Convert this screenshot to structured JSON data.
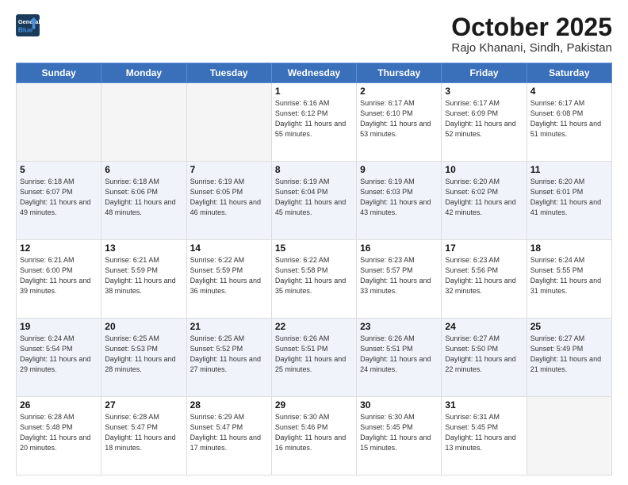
{
  "header": {
    "logo_line1": "General",
    "logo_line2": "Blue",
    "month": "October 2025",
    "location": "Rajo Khanani, Sindh, Pakistan"
  },
  "days_of_week": [
    "Sunday",
    "Monday",
    "Tuesday",
    "Wednesday",
    "Thursday",
    "Friday",
    "Saturday"
  ],
  "weeks": [
    [
      {
        "day": "",
        "sunrise": "",
        "sunset": "",
        "daylight": ""
      },
      {
        "day": "",
        "sunrise": "",
        "sunset": "",
        "daylight": ""
      },
      {
        "day": "",
        "sunrise": "",
        "sunset": "",
        "daylight": ""
      },
      {
        "day": "1",
        "sunrise": "Sunrise: 6:16 AM",
        "sunset": "Sunset: 6:12 PM",
        "daylight": "Daylight: 11 hours and 55 minutes."
      },
      {
        "day": "2",
        "sunrise": "Sunrise: 6:17 AM",
        "sunset": "Sunset: 6:10 PM",
        "daylight": "Daylight: 11 hours and 53 minutes."
      },
      {
        "day": "3",
        "sunrise": "Sunrise: 6:17 AM",
        "sunset": "Sunset: 6:09 PM",
        "daylight": "Daylight: 11 hours and 52 minutes."
      },
      {
        "day": "4",
        "sunrise": "Sunrise: 6:17 AM",
        "sunset": "Sunset: 6:08 PM",
        "daylight": "Daylight: 11 hours and 51 minutes."
      }
    ],
    [
      {
        "day": "5",
        "sunrise": "Sunrise: 6:18 AM",
        "sunset": "Sunset: 6:07 PM",
        "daylight": "Daylight: 11 hours and 49 minutes."
      },
      {
        "day": "6",
        "sunrise": "Sunrise: 6:18 AM",
        "sunset": "Sunset: 6:06 PM",
        "daylight": "Daylight: 11 hours and 48 minutes."
      },
      {
        "day": "7",
        "sunrise": "Sunrise: 6:19 AM",
        "sunset": "Sunset: 6:05 PM",
        "daylight": "Daylight: 11 hours and 46 minutes."
      },
      {
        "day": "8",
        "sunrise": "Sunrise: 6:19 AM",
        "sunset": "Sunset: 6:04 PM",
        "daylight": "Daylight: 11 hours and 45 minutes."
      },
      {
        "day": "9",
        "sunrise": "Sunrise: 6:19 AM",
        "sunset": "Sunset: 6:03 PM",
        "daylight": "Daylight: 11 hours and 43 minutes."
      },
      {
        "day": "10",
        "sunrise": "Sunrise: 6:20 AM",
        "sunset": "Sunset: 6:02 PM",
        "daylight": "Daylight: 11 hours and 42 minutes."
      },
      {
        "day": "11",
        "sunrise": "Sunrise: 6:20 AM",
        "sunset": "Sunset: 6:01 PM",
        "daylight": "Daylight: 11 hours and 41 minutes."
      }
    ],
    [
      {
        "day": "12",
        "sunrise": "Sunrise: 6:21 AM",
        "sunset": "Sunset: 6:00 PM",
        "daylight": "Daylight: 11 hours and 39 minutes."
      },
      {
        "day": "13",
        "sunrise": "Sunrise: 6:21 AM",
        "sunset": "Sunset: 5:59 PM",
        "daylight": "Daylight: 11 hours and 38 minutes."
      },
      {
        "day": "14",
        "sunrise": "Sunrise: 6:22 AM",
        "sunset": "Sunset: 5:59 PM",
        "daylight": "Daylight: 11 hours and 36 minutes."
      },
      {
        "day": "15",
        "sunrise": "Sunrise: 6:22 AM",
        "sunset": "Sunset: 5:58 PM",
        "daylight": "Daylight: 11 hours and 35 minutes."
      },
      {
        "day": "16",
        "sunrise": "Sunrise: 6:23 AM",
        "sunset": "Sunset: 5:57 PM",
        "daylight": "Daylight: 11 hours and 33 minutes."
      },
      {
        "day": "17",
        "sunrise": "Sunrise: 6:23 AM",
        "sunset": "Sunset: 5:56 PM",
        "daylight": "Daylight: 11 hours and 32 minutes."
      },
      {
        "day": "18",
        "sunrise": "Sunrise: 6:24 AM",
        "sunset": "Sunset: 5:55 PM",
        "daylight": "Daylight: 11 hours and 31 minutes."
      }
    ],
    [
      {
        "day": "19",
        "sunrise": "Sunrise: 6:24 AM",
        "sunset": "Sunset: 5:54 PM",
        "daylight": "Daylight: 11 hours and 29 minutes."
      },
      {
        "day": "20",
        "sunrise": "Sunrise: 6:25 AM",
        "sunset": "Sunset: 5:53 PM",
        "daylight": "Daylight: 11 hours and 28 minutes."
      },
      {
        "day": "21",
        "sunrise": "Sunrise: 6:25 AM",
        "sunset": "Sunset: 5:52 PM",
        "daylight": "Daylight: 11 hours and 27 minutes."
      },
      {
        "day": "22",
        "sunrise": "Sunrise: 6:26 AM",
        "sunset": "Sunset: 5:51 PM",
        "daylight": "Daylight: 11 hours and 25 minutes."
      },
      {
        "day": "23",
        "sunrise": "Sunrise: 6:26 AM",
        "sunset": "Sunset: 5:51 PM",
        "daylight": "Daylight: 11 hours and 24 minutes."
      },
      {
        "day": "24",
        "sunrise": "Sunrise: 6:27 AM",
        "sunset": "Sunset: 5:50 PM",
        "daylight": "Daylight: 11 hours and 22 minutes."
      },
      {
        "day": "25",
        "sunrise": "Sunrise: 6:27 AM",
        "sunset": "Sunset: 5:49 PM",
        "daylight": "Daylight: 11 hours and 21 minutes."
      }
    ],
    [
      {
        "day": "26",
        "sunrise": "Sunrise: 6:28 AM",
        "sunset": "Sunset: 5:48 PM",
        "daylight": "Daylight: 11 hours and 20 minutes."
      },
      {
        "day": "27",
        "sunrise": "Sunrise: 6:28 AM",
        "sunset": "Sunset: 5:47 PM",
        "daylight": "Daylight: 11 hours and 18 minutes."
      },
      {
        "day": "28",
        "sunrise": "Sunrise: 6:29 AM",
        "sunset": "Sunset: 5:47 PM",
        "daylight": "Daylight: 11 hours and 17 minutes."
      },
      {
        "day": "29",
        "sunrise": "Sunrise: 6:30 AM",
        "sunset": "Sunset: 5:46 PM",
        "daylight": "Daylight: 11 hours and 16 minutes."
      },
      {
        "day": "30",
        "sunrise": "Sunrise: 6:30 AM",
        "sunset": "Sunset: 5:45 PM",
        "daylight": "Daylight: 11 hours and 15 minutes."
      },
      {
        "day": "31",
        "sunrise": "Sunrise: 6:31 AM",
        "sunset": "Sunset: 5:45 PM",
        "daylight": "Daylight: 11 hours and 13 minutes."
      },
      {
        "day": "",
        "sunrise": "",
        "sunset": "",
        "daylight": ""
      }
    ]
  ]
}
